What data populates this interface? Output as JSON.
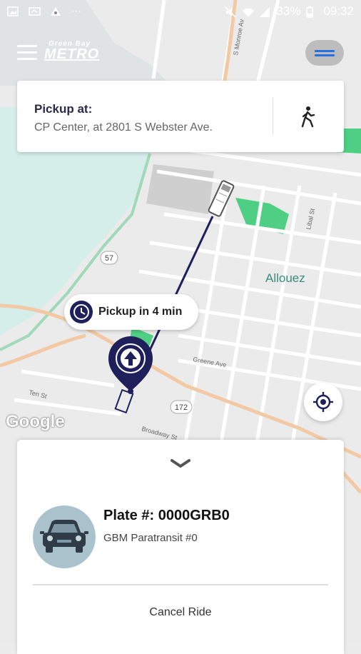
{
  "status_bar": {
    "battery": "33%",
    "time": "09:32"
  },
  "header": {
    "logo_top": "Green Bay",
    "logo_main": "METRO"
  },
  "pickup": {
    "title": "Pickup at:",
    "address": "CP Center, at 2801 S Webster Ave."
  },
  "map": {
    "eta": "Pickup in 4 min",
    "place_label": "Allouez",
    "route_shields": [
      "57",
      "172"
    ],
    "street_labels": [
      "S Monroe Av",
      "Libal St",
      "Greene Ave",
      "Broadway St",
      "Ten St"
    ],
    "attribution": "Google"
  },
  "ride": {
    "plate": "Plate #: 0000GRB0",
    "vehicle": "GBM Paratransit #0",
    "cancel_label": "Cancel Ride"
  },
  "colors": {
    "route": "#1f1f5c",
    "park": "#4fcf83",
    "water": "#d6eeea",
    "accent": "#2a6fe0"
  },
  "icons": [
    "menu-icon",
    "menu-toggle-icon",
    "walk-icon",
    "clock-icon",
    "pickup-pin-icon",
    "bus-icon",
    "locate-icon",
    "chevron-down-icon",
    "car-icon"
  ]
}
